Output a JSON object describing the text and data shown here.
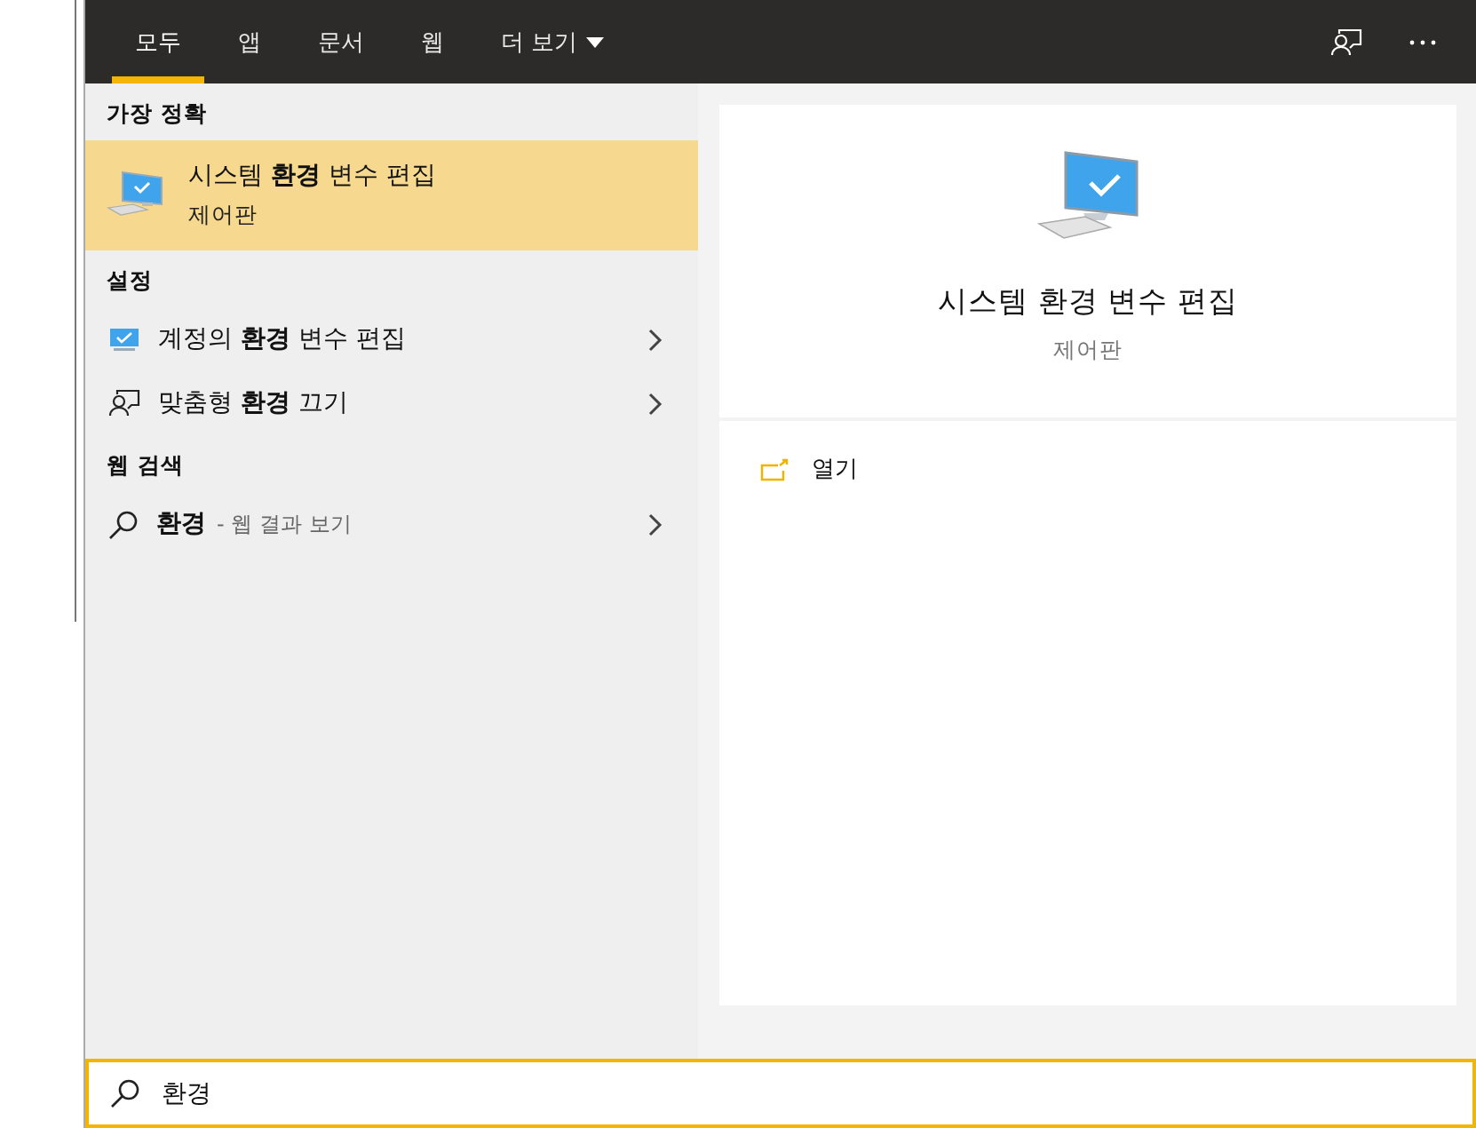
{
  "tabs": [
    {
      "label": "모두",
      "selected": true,
      "kind": "tab"
    },
    {
      "label": "앱",
      "selected": false,
      "kind": "tab"
    },
    {
      "label": "문서",
      "selected": false,
      "kind": "tab"
    },
    {
      "label": "웹",
      "selected": false,
      "kind": "tab"
    },
    {
      "label": "더 보기",
      "selected": false,
      "kind": "dropdown"
    }
  ],
  "best_match": {
    "heading": "가장 정확",
    "title": "시스템 **환경** 변수 편집",
    "subtitle": "제어판",
    "selected": true
  },
  "sections": [
    {
      "heading": "설정",
      "items": [
        {
          "kind": "monitor",
          "text": "계정의 **환경** 변수 편집"
        },
        {
          "kind": "feedback",
          "text": "맞춤형 **환경** 끄기"
        }
      ]
    },
    {
      "heading": "웹 검색",
      "items": [
        {
          "kind": "web",
          "text": "환경",
          "hint": "- 웹 결과 보기"
        }
      ]
    }
  ],
  "detail": {
    "title": "시스템 환경 변수 편집",
    "subtitle": "제어판",
    "actions": [
      {
        "label": "열기"
      }
    ]
  },
  "search": {
    "value": "환경"
  }
}
